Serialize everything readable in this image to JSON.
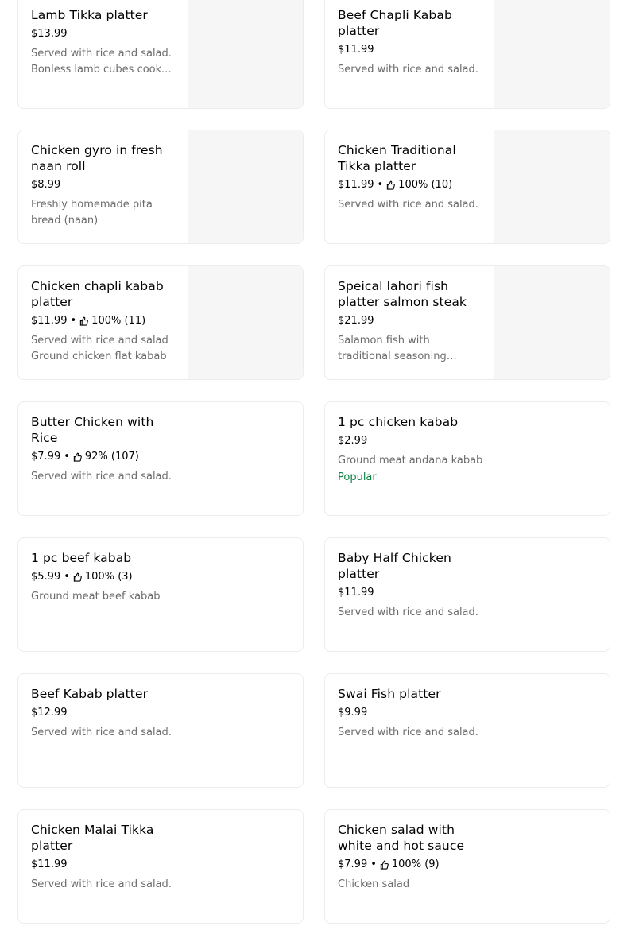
{
  "menu_items": [
    {
      "title": "Lamb Tikka platter",
      "price": "$13.99",
      "rating": "",
      "description": "Served with rice and salad. Bonless lamb cubes cooked in traditional spices",
      "badge": "",
      "has_image": true
    },
    {
      "title": "Beef Chapli Kabab platter",
      "price": "$11.99",
      "rating": "",
      "description": "Served with rice and salad.",
      "badge": "",
      "has_image": true
    },
    {
      "title": "Chicken gyro in fresh naan roll",
      "price": "$8.99",
      "rating": "",
      "description": "Freshly homemade pita bread (naan)",
      "badge": "",
      "has_image": true
    },
    {
      "title": "Chicken Traditional Tikka platter",
      "price": "$11.99",
      "rating": "100% (10)",
      "description": "Served with rice and salad.",
      "badge": "",
      "has_image": true
    },
    {
      "title": "Chicken chapli kabab platter",
      "price": "$11.99",
      "rating": "100% (11)",
      "description": "Served with rice and salad Ground chicken flat kabab",
      "badge": "",
      "has_image": true
    },
    {
      "title": "Speical lahori  fish platter salmon steak",
      "price": "$21.99",
      "rating": "",
      "description": "Salamon fish with traditional seasoning comes with rice and salad",
      "badge": "",
      "has_image": true
    },
    {
      "title": "Butter Chicken with Rice",
      "price": "$7.99",
      "rating": "92% (107)",
      "description": "Served with rice and salad.",
      "badge": "",
      "has_image": false
    },
    {
      "title": "1 pc chicken kabab",
      "price": "$2.99",
      "rating": "",
      "description": "Ground meat andana kabab",
      "badge": "Popular",
      "has_image": false
    },
    {
      "title": "1 pc beef kabab",
      "price": "$5.99",
      "rating": "100% (3)",
      "description": "Ground meat beef kabab",
      "badge": "",
      "has_image": false
    },
    {
      "title": "Baby Half Chicken platter",
      "price": "$11.99",
      "rating": "",
      "description": "Served with rice and salad.",
      "badge": "",
      "has_image": false
    },
    {
      "title": "Beef Kabab platter",
      "price": "$12.99",
      "rating": "",
      "description": "Served with rice and salad.",
      "badge": "",
      "has_image": false
    },
    {
      "title": "Swai Fish platter",
      "price": "$9.99",
      "rating": "",
      "description": "Served with rice and salad.",
      "badge": "",
      "has_image": false
    },
    {
      "title": "Chicken Malai Tikka platter",
      "price": "$11.99",
      "rating": "",
      "description": "Served with rice and salad.",
      "badge": "",
      "has_image": false
    },
    {
      "title": "Chicken salad with white and hot sauce",
      "price": "$7.99",
      "rating": "100% (9)",
      "description": "Chicken salad",
      "badge": "",
      "has_image": false
    }
  ],
  "colors": {
    "popular_badge": "#0e8345",
    "description": "#6b6b6b",
    "image_placeholder": "#f6f6f6",
    "card_border": "#ececec"
  },
  "icons": {
    "rating": "thumbs-up-icon"
  }
}
